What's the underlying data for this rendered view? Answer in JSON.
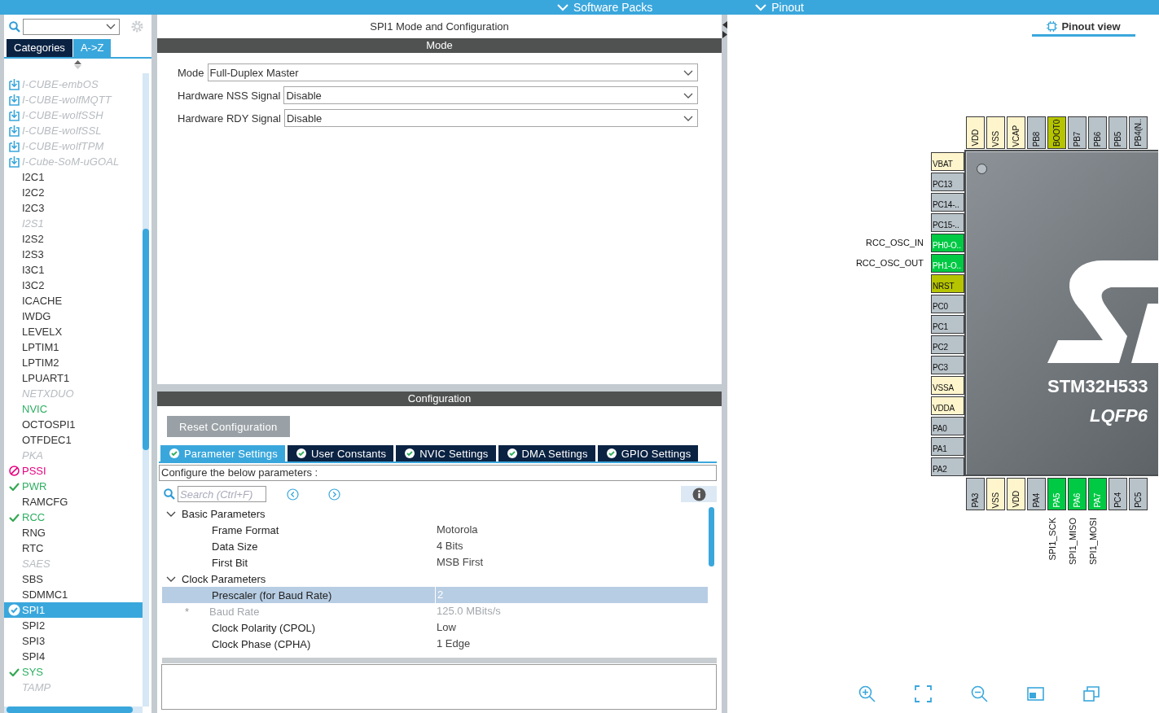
{
  "top_bar": {
    "items": [
      {
        "label": "Software Packs"
      },
      {
        "label": "Pinout"
      }
    ]
  },
  "sidebar": {
    "tabs": [
      {
        "label": "Categories",
        "selected": false
      },
      {
        "label": "A->Z",
        "selected": true
      }
    ],
    "items": [
      {
        "label": "I-CUBE-embOS",
        "kind": "pack",
        "color": "#b7bcc1",
        "disabled": true,
        "configured": false,
        "error": false,
        "selected": false
      },
      {
        "label": "I-CUBE-wolfMQTT",
        "kind": "pack",
        "color": "#b7bcc1",
        "disabled": true,
        "configured": false,
        "error": false,
        "selected": false
      },
      {
        "label": "I-CUBE-wolfSSH",
        "kind": "pack",
        "color": "#b7bcc1",
        "disabled": true,
        "configured": false,
        "error": false,
        "selected": false
      },
      {
        "label": "I-CUBE-wolfSSL",
        "kind": "pack",
        "color": "#b7bcc1",
        "disabled": true,
        "configured": false,
        "error": false,
        "selected": false
      },
      {
        "label": "I-CUBE-wolfTPM",
        "kind": "pack",
        "color": "#b7bcc1",
        "disabled": true,
        "configured": false,
        "error": false,
        "selected": false
      },
      {
        "label": "I-Cube-SoM-uGOAL",
        "kind": "pack",
        "color": "#b7bcc1",
        "disabled": true,
        "configured": false,
        "error": false,
        "selected": false
      },
      {
        "label": "I2C1",
        "kind": "peripheral",
        "color": "#333333",
        "disabled": false,
        "configured": false,
        "error": false,
        "selected": false
      },
      {
        "label": "I2C2",
        "kind": "peripheral",
        "color": "#333333",
        "disabled": false,
        "configured": false,
        "error": false,
        "selected": false
      },
      {
        "label": "I2C3",
        "kind": "peripheral",
        "color": "#333333",
        "disabled": false,
        "configured": false,
        "error": false,
        "selected": false
      },
      {
        "label": "I2S1",
        "kind": "peripheral",
        "color": "#b7bcc1",
        "disabled": true,
        "configured": false,
        "error": false,
        "selected": false
      },
      {
        "label": "I2S2",
        "kind": "peripheral",
        "color": "#333333",
        "disabled": false,
        "configured": false,
        "error": false,
        "selected": false
      },
      {
        "label": "I2S3",
        "kind": "peripheral",
        "color": "#333333",
        "disabled": false,
        "configured": false,
        "error": false,
        "selected": false
      },
      {
        "label": "I3C1",
        "kind": "peripheral",
        "color": "#333333",
        "disabled": false,
        "configured": false,
        "error": false,
        "selected": false
      },
      {
        "label": "I3C2",
        "kind": "peripheral",
        "color": "#333333",
        "disabled": false,
        "configured": false,
        "error": false,
        "selected": false
      },
      {
        "label": "ICACHE",
        "kind": "peripheral",
        "color": "#333333",
        "disabled": false,
        "configured": false,
        "error": false,
        "selected": false
      },
      {
        "label": "IWDG",
        "kind": "peripheral",
        "color": "#333333",
        "disabled": false,
        "configured": false,
        "error": false,
        "selected": false
      },
      {
        "label": "LEVELX",
        "kind": "peripheral",
        "color": "#333333",
        "disabled": false,
        "configured": false,
        "error": false,
        "selected": false
      },
      {
        "label": "LPTIM1",
        "kind": "peripheral",
        "color": "#333333",
        "disabled": false,
        "configured": false,
        "error": false,
        "selected": false
      },
      {
        "label": "LPTIM2",
        "kind": "peripheral",
        "color": "#333333",
        "disabled": false,
        "configured": false,
        "error": false,
        "selected": false
      },
      {
        "label": "LPUART1",
        "kind": "peripheral",
        "color": "#333333",
        "disabled": false,
        "configured": false,
        "error": false,
        "selected": false
      },
      {
        "label": "NETXDUO",
        "kind": "peripheral",
        "color": "#b7bcc1",
        "disabled": true,
        "configured": false,
        "error": false,
        "selected": false
      },
      {
        "label": "NVIC",
        "kind": "peripheral",
        "color": "#2eaf62",
        "disabled": false,
        "configured": false,
        "error": false,
        "selected": false
      },
      {
        "label": "OCTOSPI1",
        "kind": "peripheral",
        "color": "#333333",
        "disabled": false,
        "configured": false,
        "error": false,
        "selected": false
      },
      {
        "label": "OTFDEC1",
        "kind": "peripheral",
        "color": "#333333",
        "disabled": false,
        "configured": false,
        "error": false,
        "selected": false
      },
      {
        "label": "PKA",
        "kind": "peripheral",
        "color": "#b7bcc1",
        "disabled": true,
        "configured": false,
        "error": false,
        "selected": false
      },
      {
        "label": "PSSI",
        "kind": "peripheral",
        "color": "#e6007e",
        "disabled": false,
        "configured": false,
        "error": true,
        "selected": false
      },
      {
        "label": "PWR",
        "kind": "peripheral",
        "color": "#2eaf62",
        "disabled": false,
        "configured": true,
        "error": false,
        "selected": false
      },
      {
        "label": "RAMCFG",
        "kind": "peripheral",
        "color": "#333333",
        "disabled": false,
        "configured": false,
        "error": false,
        "selected": false
      },
      {
        "label": "RCC",
        "kind": "peripheral",
        "color": "#2eaf62",
        "disabled": false,
        "configured": true,
        "error": false,
        "selected": false
      },
      {
        "label": "RNG",
        "kind": "peripheral",
        "color": "#333333",
        "disabled": false,
        "configured": false,
        "error": false,
        "selected": false
      },
      {
        "label": "RTC",
        "kind": "peripheral",
        "color": "#333333",
        "disabled": false,
        "configured": false,
        "error": false,
        "selected": false
      },
      {
        "label": "SAES",
        "kind": "peripheral",
        "color": "#b7bcc1",
        "disabled": true,
        "configured": false,
        "error": false,
        "selected": false
      },
      {
        "label": "SBS",
        "kind": "peripheral",
        "color": "#333333",
        "disabled": false,
        "configured": false,
        "error": false,
        "selected": false
      },
      {
        "label": "SDMMC1",
        "kind": "peripheral",
        "color": "#333333",
        "disabled": false,
        "configured": false,
        "error": false,
        "selected": false
      },
      {
        "label": "SPI1",
        "kind": "peripheral",
        "disabled": false,
        "configured": true,
        "error": false,
        "selected": true
      },
      {
        "label": "SPI2",
        "kind": "peripheral",
        "color": "#333333",
        "disabled": false,
        "configured": false,
        "error": false,
        "selected": false
      },
      {
        "label": "SPI3",
        "kind": "peripheral",
        "color": "#333333",
        "disabled": false,
        "configured": false,
        "error": false,
        "selected": false
      },
      {
        "label": "SPI4",
        "kind": "peripheral",
        "color": "#333333",
        "disabled": false,
        "configured": false,
        "error": false,
        "selected": false
      },
      {
        "label": "SYS",
        "kind": "peripheral",
        "color": "#2eaf62",
        "disabled": false,
        "configured": true,
        "error": false,
        "selected": false
      },
      {
        "label": "TAMP",
        "kind": "peripheral",
        "color": "#b7bcc1",
        "disabled": true,
        "configured": false,
        "error": false,
        "selected": false
      }
    ]
  },
  "mode_panel": {
    "title": "SPI1 Mode and Configuration",
    "header": "Mode",
    "fields": [
      {
        "label": "Mode",
        "value": "Full-Duplex Master"
      },
      {
        "label": "Hardware NSS Signal",
        "value": "Disable"
      },
      {
        "label": "Hardware RDY Signal",
        "value": "Disable"
      }
    ]
  },
  "configuration": {
    "header": "Configuration",
    "reset_button": "Reset Configuration",
    "tabs": [
      {
        "label": "Parameter Settings",
        "selected": true
      },
      {
        "label": "User Constants",
        "selected": false
      },
      {
        "label": "NVIC Settings",
        "selected": false
      },
      {
        "label": "DMA Settings",
        "selected": false
      },
      {
        "label": "GPIO Settings",
        "selected": false
      }
    ],
    "hint": "Configure the below parameters :",
    "search_placeholder": "Search (Ctrl+F)",
    "groups": [
      {
        "label": "Basic Parameters",
        "expanded": true,
        "children": [
          {
            "label": "Frame Format",
            "value": "Motorola",
            "selected": false,
            "disabled": false
          },
          {
            "label": "Data Size",
            "value": "4 Bits",
            "selected": false,
            "disabled": false
          },
          {
            "label": "First Bit",
            "value": "MSB First",
            "selected": false,
            "disabled": false
          }
        ]
      },
      {
        "label": "Clock Parameters",
        "expanded": true,
        "children": [
          {
            "label": "Prescaler (for Baud Rate)",
            "value": "2",
            "selected": true,
            "disabled": false
          },
          {
            "label": "Baud Rate",
            "value": "125.0 MBits/s",
            "selected": false,
            "disabled": true,
            "marker": "*"
          },
          {
            "label": "Clock Polarity (CPOL)",
            "value": "Low",
            "selected": false,
            "disabled": false
          },
          {
            "label": "Clock Phase (CPHA)",
            "value": "1 Edge",
            "selected": false,
            "disabled": false
          }
        ]
      }
    ]
  },
  "pinout": {
    "view_tab": {
      "label": "Pinout view",
      "selected": true
    },
    "chip": {
      "part": "STM32H533",
      "package": "LQFP6"
    },
    "left_pins": [
      {
        "name": "VBAT",
        "kind": "power"
      },
      {
        "name": "PC13",
        "kind": "io"
      },
      {
        "name": "PC14-..",
        "kind": "io"
      },
      {
        "name": "PC15-..",
        "kind": "io"
      },
      {
        "name": "PH0-O..",
        "kind": "assigned",
        "signal": "RCC_OSC_IN"
      },
      {
        "name": "PH1-O..",
        "kind": "assigned",
        "signal": "RCC_OSC_OUT"
      },
      {
        "name": "NRST",
        "kind": "fixed"
      },
      {
        "name": "PC0",
        "kind": "io"
      },
      {
        "name": "PC1",
        "kind": "io"
      },
      {
        "name": "PC2",
        "kind": "io"
      },
      {
        "name": "PC3",
        "kind": "io"
      },
      {
        "name": "VSSA",
        "kind": "power"
      },
      {
        "name": "VDDA",
        "kind": "power"
      },
      {
        "name": "PA0",
        "kind": "io"
      },
      {
        "name": "PA1",
        "kind": "io"
      },
      {
        "name": "PA2",
        "kind": "io"
      }
    ],
    "top_pins": [
      {
        "name": "VDD",
        "kind": "power"
      },
      {
        "name": "VSS",
        "kind": "power"
      },
      {
        "name": "VCAP",
        "kind": "power"
      },
      {
        "name": "PB8",
        "kind": "io"
      },
      {
        "name": "BOOT0",
        "kind": "fixed"
      },
      {
        "name": "PB7",
        "kind": "io"
      },
      {
        "name": "PB6",
        "kind": "io"
      },
      {
        "name": "PB5",
        "kind": "io"
      },
      {
        "name": "PB4(N..",
        "kind": "io"
      }
    ],
    "bottom_pins": [
      {
        "name": "PA3",
        "kind": "io"
      },
      {
        "name": "VSS",
        "kind": "power"
      },
      {
        "name": "VDD",
        "kind": "power"
      },
      {
        "name": "PA4",
        "kind": "io"
      },
      {
        "name": "PA5",
        "kind": "assigned",
        "signal": "SPI1_SCK"
      },
      {
        "name": "PA6",
        "kind": "assigned",
        "signal": "SPI1_MISO"
      },
      {
        "name": "PA7",
        "kind": "assigned",
        "signal": "SPI1_MOSI"
      },
      {
        "name": "PC4",
        "kind": "io"
      },
      {
        "name": "PC5",
        "kind": "io"
      }
    ]
  }
}
